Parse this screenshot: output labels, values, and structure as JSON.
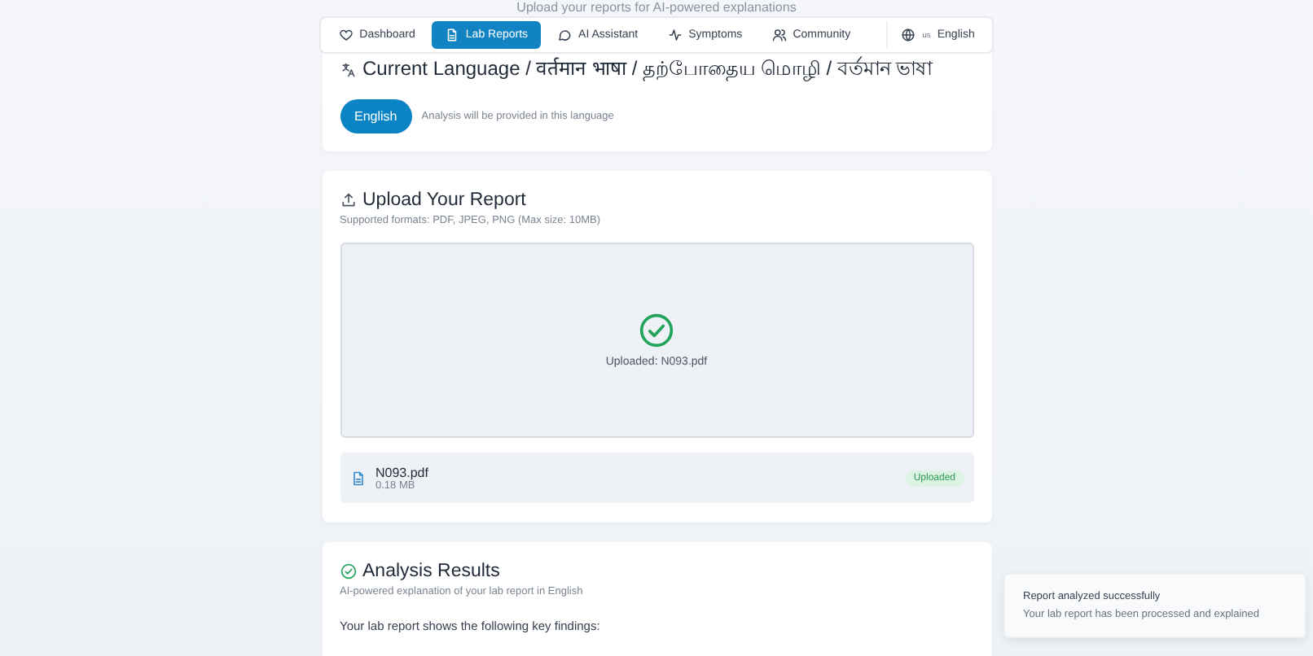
{
  "header": {
    "subtitle": "Upload your reports for AI-powered explanations"
  },
  "nav": {
    "tabs": [
      {
        "label": "Dashboard",
        "selected": false
      },
      {
        "label": "Lab Reports",
        "selected": true
      },
      {
        "label": "AI Assistant",
        "selected": false
      },
      {
        "label": "Symptoms",
        "selected": false
      },
      {
        "label": "Community",
        "selected": false
      }
    ],
    "language": {
      "flag": "us",
      "label": "English"
    }
  },
  "language_card": {
    "title": "Current Language / वर्तमान भाषा / தற்போதைய மொழி / বর্তমান ভাষা",
    "button": "English",
    "note": "Analysis will be provided in this language"
  },
  "upload_card": {
    "title": "Upload Your Report",
    "subtitle": "Supported formats: PDF, JPEG, PNG (Max size: 10MB)",
    "dropzone_text": "Uploaded: N093.pdf",
    "file": {
      "name": "N093.pdf",
      "size": "0.18 MB",
      "status": "Uploaded"
    }
  },
  "results_card": {
    "title": "Analysis Results",
    "subtitle": "AI-powered explanation of your lab report in English",
    "intro": "Your lab report shows the following key findings:"
  },
  "toast": {
    "title": "Report analyzed successfully",
    "message": "Your lab report has been processed and explained"
  }
}
